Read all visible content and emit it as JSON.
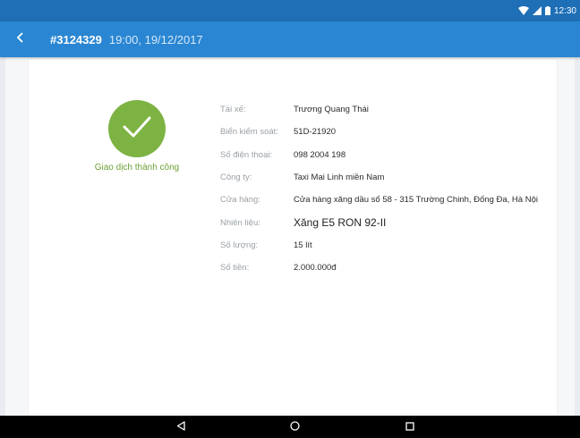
{
  "status_bar": {
    "time": "12:30",
    "icons": [
      "wifi-icon",
      "signal-icon",
      "battery-icon"
    ]
  },
  "app_bar": {
    "back_icon": "chevron-left-icon",
    "order_id": "#3124329",
    "order_time": "19:00, 19/12/2017"
  },
  "status": {
    "icon": "checkmark-icon",
    "text": "Giao dịch thành công",
    "color": "#7cb342"
  },
  "details": [
    {
      "label": "Tài xế:",
      "value": "Trương Quang Thái"
    },
    {
      "label": "Biển kiểm soát:",
      "value": "51D-21920"
    },
    {
      "label": "Số điện thoại:",
      "value": "098 2004 198"
    },
    {
      "label": "Công ty:",
      "value": "Taxi Mai Linh miền Nam"
    },
    {
      "label": "Cửa hàng:",
      "value": "Cửa hàng xăng dầu số 58 - 315 Trường Chinh, Đống Đa, Hà Nội"
    },
    {
      "label": "Nhiên liệu:",
      "value": "Xăng E5 RON 92-II"
    },
    {
      "label": "Số lượng:",
      "value": "15 lít"
    },
    {
      "label": "Số tiền:",
      "value": "2.000.000đ"
    }
  ],
  "nav_bar": {
    "back_icon": "nav-back-icon",
    "home_icon": "nav-home-icon",
    "recents_icon": "nav-recents-icon"
  },
  "colors": {
    "status_bar": "#1f6fb7",
    "app_bar": "#2a86d2",
    "success": "#7cb342"
  }
}
